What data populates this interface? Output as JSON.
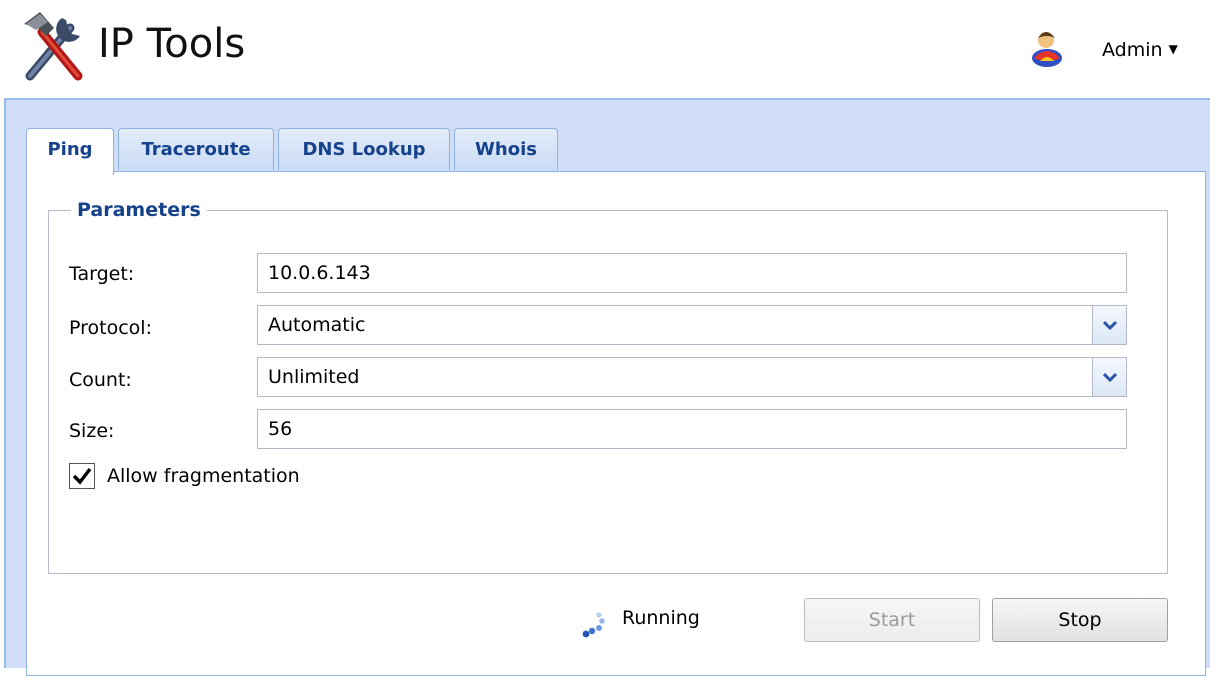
{
  "header": {
    "title": "IP Tools",
    "logo_icon": "hammer-wrench-icon",
    "user_icon": "user-icon",
    "user_name": "Admin",
    "user_menu_caret": "▼"
  },
  "tabs": [
    {
      "label": "Ping",
      "active": true
    },
    {
      "label": "Traceroute",
      "active": false
    },
    {
      "label": "DNS Lookup",
      "active": false
    },
    {
      "label": "Whois",
      "active": false
    }
  ],
  "parameters": {
    "legend": "Parameters",
    "target": {
      "label": "Target:",
      "value": "10.0.6.143"
    },
    "protocol": {
      "label": "Protocol:",
      "value": "Automatic"
    },
    "count": {
      "label": "Count:",
      "value": "Unlimited"
    },
    "size": {
      "label": "Size:",
      "value": "56"
    },
    "fragmentation": {
      "label": "Allow fragmentation",
      "checked": true
    }
  },
  "status": {
    "icon": "spinner-icon",
    "text": "Running"
  },
  "buttons": {
    "start": {
      "label": "Start",
      "enabled": false
    },
    "stop": {
      "label": "Stop",
      "enabled": true
    }
  },
  "colors": {
    "panel_bg": "#d1def7",
    "border": "#8db2e3",
    "heading": "#15428b"
  }
}
